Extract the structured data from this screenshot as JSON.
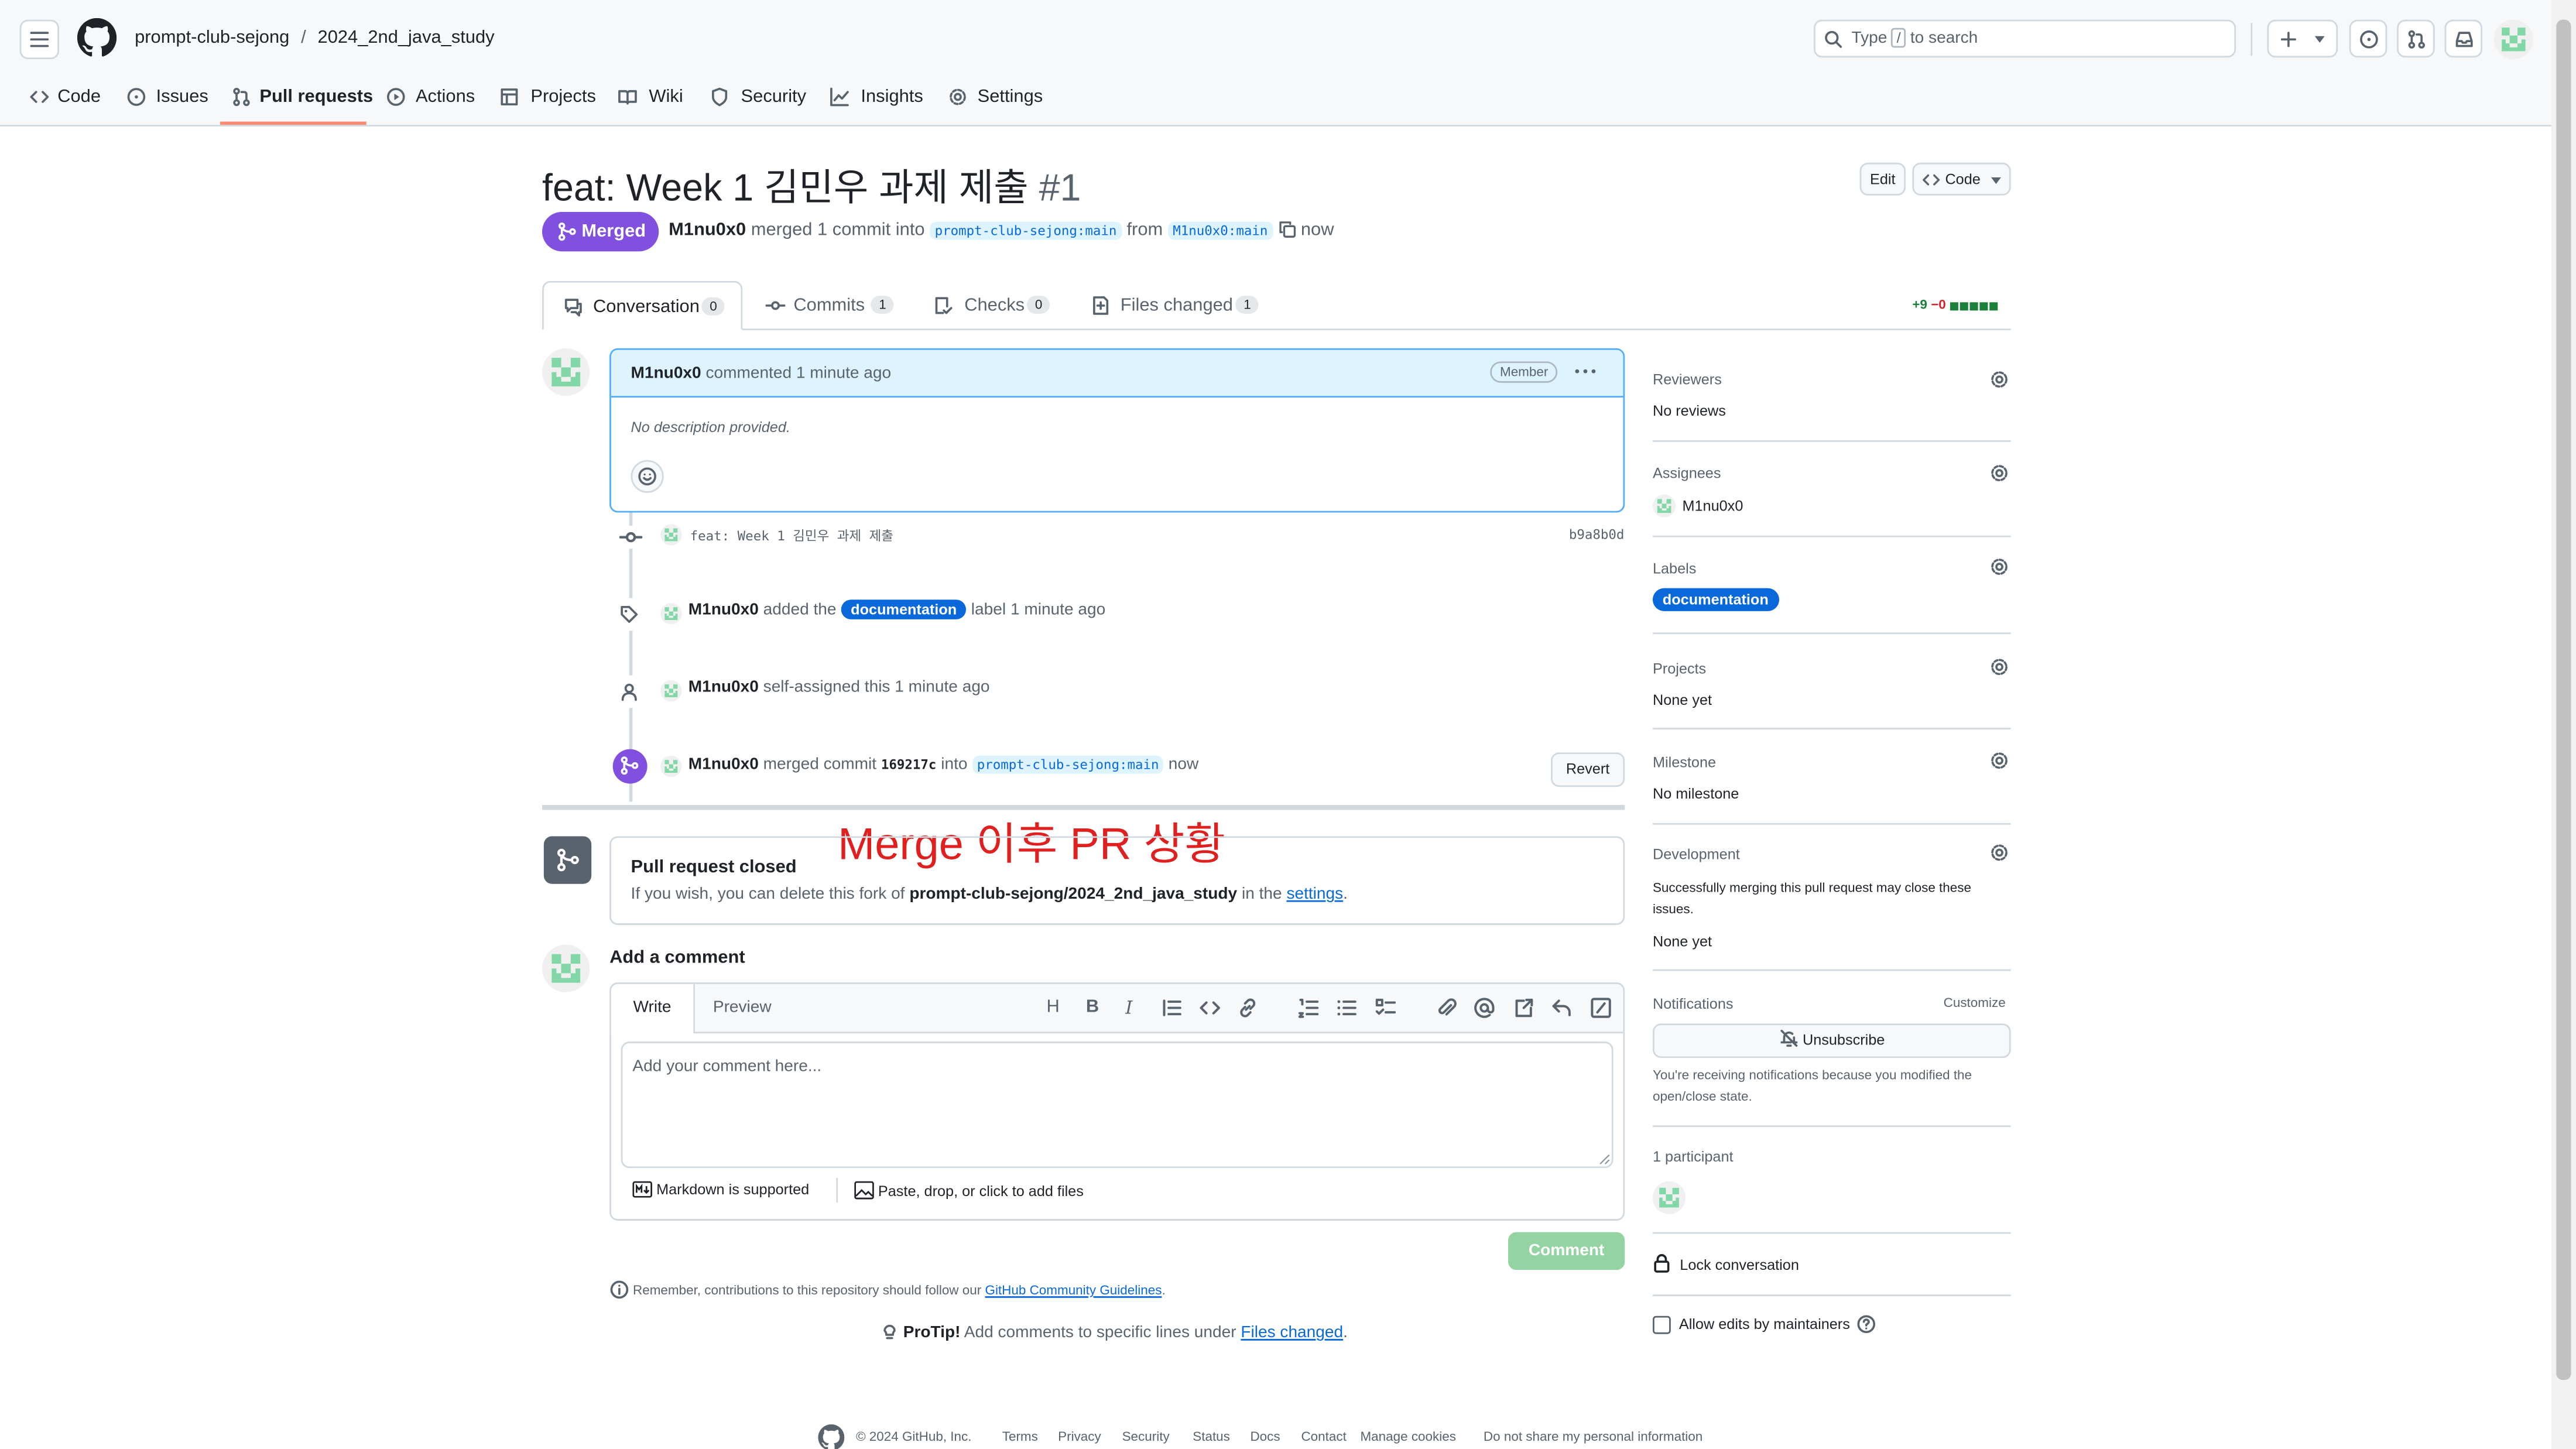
{
  "header": {
    "org": "prompt-club-sejong",
    "separator": "/",
    "repo": "2024_2nd_java_study",
    "search_prefix": "Type",
    "search_key": "/",
    "search_suffix": "to search"
  },
  "repo_nav": {
    "items": [
      {
        "label": "Code",
        "icon": "code-icon"
      },
      {
        "label": "Issues",
        "icon": "issue-icon"
      },
      {
        "label": "Pull requests",
        "icon": "pull-request-icon",
        "active": true
      },
      {
        "label": "Actions",
        "icon": "play-icon"
      },
      {
        "label": "Projects",
        "icon": "table-icon"
      },
      {
        "label": "Wiki",
        "icon": "book-icon"
      },
      {
        "label": "Security",
        "icon": "shield-icon"
      },
      {
        "label": "Insights",
        "icon": "graph-icon"
      },
      {
        "label": "Settings",
        "icon": "gear-icon"
      }
    ]
  },
  "pr": {
    "title": "feat: Week 1 김민우 과제 제출",
    "number": "#1",
    "edit_label": "Edit",
    "code_label": "Code",
    "state": "Merged",
    "author": "M1nu0x0",
    "merged_text": "merged 1 commit into",
    "base_branch": "prompt-club-sejong:main",
    "from_text": "from",
    "head_branch": "M1nu0x0:main",
    "time": "now"
  },
  "tabs": [
    {
      "label": "Conversation",
      "count": "0"
    },
    {
      "label": "Commits",
      "count": "1"
    },
    {
      "label": "Checks",
      "count": "0"
    },
    {
      "label": "Files changed",
      "count": "1"
    }
  ],
  "diffstat": {
    "additions": "+9",
    "deletions": "−0"
  },
  "comment": {
    "author": "M1nu0x0",
    "action": "commented",
    "time": "1 minute ago",
    "badge": "Member",
    "body": "No description provided."
  },
  "timeline": {
    "commit_message": "feat: Week 1 김민우 과제 제출",
    "commit_sha": "b9a8b0d",
    "label_event": {
      "user": "M1nu0x0",
      "before": "added the",
      "label": "documentation",
      "after": "label",
      "time": "1 minute ago"
    },
    "assign_event": {
      "user": "M1nu0x0",
      "text": "self-assigned this",
      "time": "1 minute ago"
    },
    "merge_event": {
      "user": "M1nu0x0",
      "text": "merged commit",
      "sha": "169217c",
      "into": "into",
      "branch": "prompt-club-sejong:main",
      "time": "now",
      "revert": "Revert"
    }
  },
  "annotation": {
    "text": "Merge 이후 PR 상황",
    "color": "#e0201f"
  },
  "closed_box": {
    "title": "Pull request closed",
    "text_before": "If you wish, you can delete this fork of",
    "repo_full": "prompt-club-sejong/2024_2nd_java_study",
    "text_mid": "in the",
    "settings_link": "settings",
    "period": "."
  },
  "add_comment": {
    "heading": "Add a comment",
    "tab_write": "Write",
    "tab_preview": "Preview",
    "placeholder": "Add your comment here...",
    "markdown_note": "Markdown is supported",
    "attach_note": "Paste, drop, or click to add files",
    "submit": "Comment",
    "remember_before": "Remember, contributions to this repository should follow our",
    "remember_link": "GitHub Community Guidelines",
    "remember_after": ".",
    "protip_label": "ProTip!",
    "protip_before": "Add comments to specific lines under",
    "protip_link": "Files changed",
    "protip_after": "."
  },
  "sidebar": {
    "reviewers": {
      "title": "Reviewers",
      "value": "No reviews"
    },
    "assignees": {
      "title": "Assignees",
      "value": "M1nu0x0"
    },
    "labels": {
      "title": "Labels",
      "value": "documentation"
    },
    "projects": {
      "title": "Projects",
      "value": "None yet"
    },
    "milestone": {
      "title": "Milestone",
      "value": "No milestone"
    },
    "development": {
      "title": "Development",
      "note": "Successfully merging this pull request may close these issues.",
      "value": "None yet"
    },
    "notifications": {
      "title": "Notifications",
      "customize": "Customize",
      "button": "Unsubscribe",
      "note": "You're receiving notifications because you modified the open/close state."
    },
    "participants": {
      "title": "1 participant"
    },
    "lock": "Lock conversation",
    "allow_edits": "Allow edits by maintainers"
  },
  "footer": {
    "copyright": "© 2024 GitHub, Inc.",
    "links": [
      "Terms",
      "Privacy",
      "Security",
      "Status",
      "Docs",
      "Contact",
      "Manage cookies",
      "Do not share my personal information"
    ]
  },
  "colors": {
    "accent": "#0969da",
    "merged": "#8250df",
    "avatar": "#81d8a6"
  }
}
